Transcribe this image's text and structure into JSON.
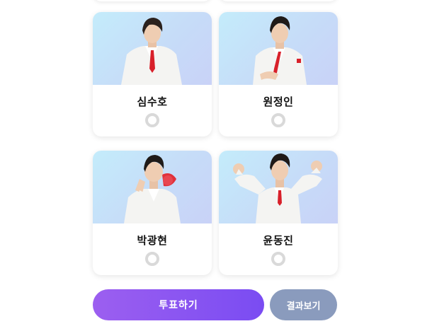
{
  "candidates": [
    {
      "name": "심수호"
    },
    {
      "name": "원정인"
    },
    {
      "name": "박광현"
    },
    {
      "name": "윤동진"
    }
  ],
  "actions": {
    "vote_label": "투표하기",
    "results_label": "결과보기"
  },
  "colors": {
    "photo_bg_start": "#c4ecfb",
    "photo_bg_end": "#c9d2f7",
    "vote_gradient_start": "#9c5ff0",
    "vote_gradient_end": "#7a4cf2",
    "results_bg": "#8a9bbd",
    "radio_border": "#d9d9d9"
  }
}
